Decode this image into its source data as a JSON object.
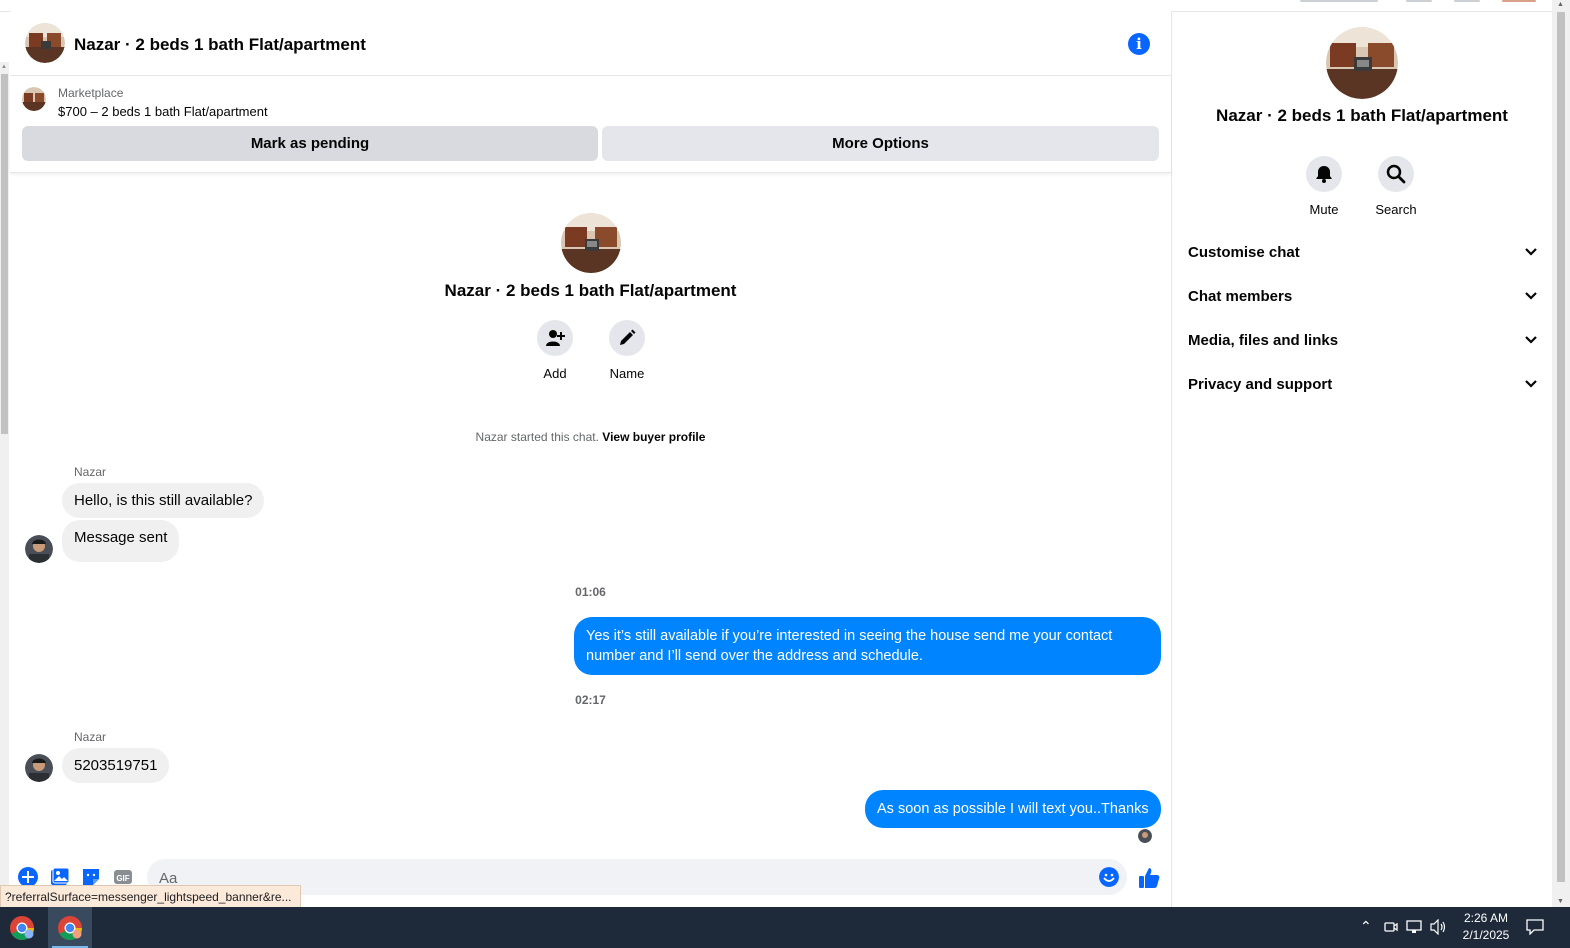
{
  "chat": {
    "title": "Nazar · 2 beds 1 bath Flat/apartment",
    "marketplace": {
      "label": "Marketplace",
      "listing": "$700 – 2 beds 1 bath Flat/apartment",
      "pending_button": "Mark as pending",
      "options_button": "More Options"
    },
    "intro": {
      "title": "Nazar · 2 beds 1 bath Flat/apartment",
      "add_label": "Add",
      "name_label": "Name",
      "started_text": "Nazar started this chat.",
      "view_profile": "View buyer profile"
    },
    "messages": {
      "sender_1": "Nazar",
      "in_1": "Hello, is this still available?",
      "in_2": "Message sent",
      "time_1": "01:06",
      "out_1": "Yes it’s still available if you’re interested in seeing the house send me your contact number and I’ll send over the address and schedule.",
      "time_2": "02:17",
      "sender_2": "Nazar",
      "in_3": "5203519751",
      "out_2": "As soon as possible I will text you..Thanks"
    },
    "composer": {
      "placeholder": "Aa"
    }
  },
  "status_url": "?referralSurface=messenger_lightspeed_banner&re...",
  "side_panel": {
    "title": "Nazar · 2 beds 1 bath Flat/apartment",
    "mute_label": "Mute",
    "search_label": "Search",
    "sections": [
      "Customise chat",
      "Chat members",
      "Media, files and links",
      "Privacy and support"
    ]
  },
  "taskbar": {
    "time": "2:26 AM",
    "date": "2/1/2025"
  },
  "colors": {
    "accent": "#0866ff",
    "outgoing_bubble": "#0084ff",
    "incoming_bubble": "#f0f0f0"
  }
}
